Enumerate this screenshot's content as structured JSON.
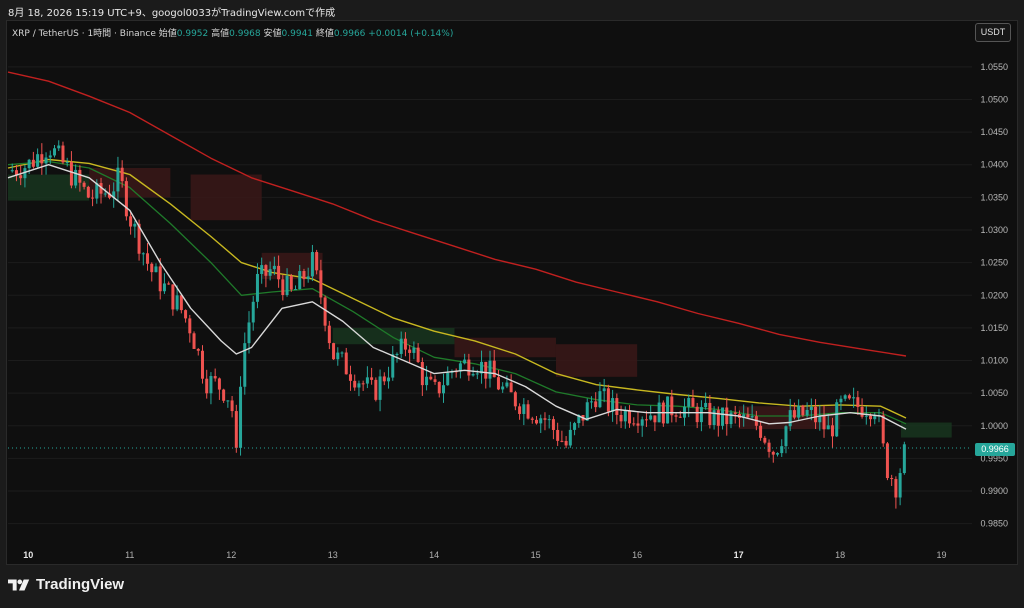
{
  "caption": "8月 18, 2026 15:19 UTC+9、googol0033がTradingView.comで作成",
  "legend": {
    "symbol": "XRP / TetherUS · 1時間 · Binance",
    "open_label": "始値",
    "open": "0.9952",
    "high_label": "高値",
    "high": "0.9968",
    "low_label": "安値",
    "low": "0.9941",
    "close_label": "終値",
    "close": "0.9966",
    "change": "+0.0014 (+0.14%)"
  },
  "currency_button": "USDT",
  "last_price_tag": "0.9966",
  "footer_brand": "TradingView",
  "colors": {
    "up": "#26a69a",
    "down": "#ef5350",
    "ma_white": "#d9d9d9",
    "ma_green": "#1f7a2a",
    "ma_yellow": "#c8b820",
    "ma_red": "#c0201f",
    "cloud_green": "#17351f",
    "cloud_red": "#3a1717"
  },
  "chart_data": {
    "type": "candlestick",
    "x_tick_labels": [
      "10",
      "11",
      "12",
      "13",
      "14",
      "15",
      "16",
      "17",
      "18",
      "19"
    ],
    "bold_x_ticks": [
      "10",
      "17"
    ],
    "y_tick_labels": [
      "1.0550",
      "1.0500",
      "1.0450",
      "1.0400",
      "1.0350",
      "1.0300",
      "1.0250",
      "1.0200",
      "1.0150",
      "1.0100",
      "1.0050",
      "1.0000",
      "0.9950",
      "0.9900",
      "0.9850"
    ],
    "ylim": [
      0.9825,
      1.0585
    ],
    "xlim_days": [
      9.8,
      19.3
    ],
    "last_price": 0.9966,
    "approx_path_close": [
      [
        9.8,
        1.039
      ],
      [
        10.0,
        1.04
      ],
      [
        10.2,
        1.043
      ],
      [
        10.4,
        1.039
      ],
      [
        10.6,
        1.035
      ],
      [
        10.8,
        1.036
      ],
      [
        10.9,
        1.038
      ],
      [
        11.0,
        1.032
      ],
      [
        11.2,
        1.024
      ],
      [
        11.5,
        1.018
      ],
      [
        11.6,
        1.015
      ],
      [
        11.75,
        1.007
      ],
      [
        11.9,
        1.006
      ],
      [
        12.0,
        1.004
      ],
      [
        12.05,
        0.995
      ],
      [
        12.1,
        1.01
      ],
      [
        12.25,
        1.022
      ],
      [
        12.4,
        1.024
      ],
      [
        12.6,
        1.02
      ],
      [
        12.8,
        1.025
      ],
      [
        12.9,
        1.019
      ],
      [
        13.0,
        1.011
      ],
      [
        13.2,
        1.008
      ],
      [
        13.4,
        1.005
      ],
      [
        13.6,
        1.01
      ],
      [
        13.75,
        1.013
      ],
      [
        13.9,
        1.007
      ],
      [
        14.0,
        1.005
      ],
      [
        14.2,
        1.009
      ],
      [
        14.4,
        1.01
      ],
      [
        14.55,
        1.008
      ],
      [
        14.7,
        1.005
      ],
      [
        14.9,
        1.003
      ],
      [
        15.1,
        1.001
      ],
      [
        15.3,
        0.997
      ],
      [
        15.4,
        1.0
      ],
      [
        15.6,
        1.005
      ],
      [
        15.8,
        1.002
      ],
      [
        16.0,
        1.002
      ],
      [
        16.2,
        1.002
      ],
      [
        16.4,
        1.003
      ],
      [
        16.6,
        1.002
      ],
      [
        16.8,
        1.001
      ],
      [
        17.0,
        1.001
      ],
      [
        17.2,
        1.0
      ],
      [
        17.35,
        0.996
      ],
      [
        17.5,
        1.001
      ],
      [
        17.7,
        1.002
      ],
      [
        17.9,
        0.999
      ],
      [
        18.0,
        1.003
      ],
      [
        18.2,
        1.003
      ],
      [
        18.35,
        1.003
      ],
      [
        18.45,
        0.994
      ],
      [
        18.55,
        0.991
      ],
      [
        18.65,
        0.9966
      ]
    ],
    "ma_white": [
      [
        9.8,
        1.038
      ],
      [
        10.2,
        1.04
      ],
      [
        10.6,
        1.038
      ],
      [
        11.0,
        1.033
      ],
      [
        11.3,
        1.025
      ],
      [
        11.6,
        1.018
      ],
      [
        11.9,
        1.013
      ],
      [
        12.05,
        1.011
      ],
      [
        12.2,
        1.012
      ],
      [
        12.5,
        1.018
      ],
      [
        12.8,
        1.019
      ],
      [
        13.1,
        1.016
      ],
      [
        13.4,
        1.012
      ],
      [
        13.7,
        1.01
      ],
      [
        14.0,
        1.008
      ],
      [
        14.3,
        1.0085
      ],
      [
        14.6,
        1.008
      ],
      [
        14.9,
        1.006
      ],
      [
        15.2,
        1.003
      ],
      [
        15.5,
        1.001
      ],
      [
        15.8,
        1.0025
      ],
      [
        16.1,
        1.002
      ],
      [
        16.4,
        1.002
      ],
      [
        16.7,
        1.002
      ],
      [
        17.0,
        1.0015
      ],
      [
        17.3,
        1.0003
      ],
      [
        17.5,
        1.0005
      ],
      [
        17.8,
        1.0015
      ],
      [
        18.1,
        1.002
      ],
      [
        18.4,
        1.0015
      ],
      [
        18.65,
        0.9995
      ]
    ],
    "ma_green": [
      [
        9.8,
        1.04
      ],
      [
        10.2,
        1.0405
      ],
      [
        10.6,
        1.0395
      ],
      [
        11.0,
        1.0365
      ],
      [
        11.4,
        1.031
      ],
      [
        11.8,
        1.025
      ],
      [
        12.1,
        1.02
      ],
      [
        12.4,
        1.0205
      ],
      [
        12.8,
        1.021
      ],
      [
        13.2,
        1.0175
      ],
      [
        13.6,
        1.0135
      ],
      [
        14.0,
        1.0105
      ],
      [
        14.4,
        1.0095
      ],
      [
        14.8,
        1.008
      ],
      [
        15.2,
        1.0052
      ],
      [
        15.6,
        1.004
      ],
      [
        16.0,
        1.0032
      ],
      [
        16.4,
        1.003
      ],
      [
        16.8,
        1.0025
      ],
      [
        17.2,
        1.0015
      ],
      [
        17.6,
        1.0015
      ],
      [
        18.0,
        1.002
      ],
      [
        18.4,
        1.002
      ],
      [
        18.65,
        1.0003
      ]
    ],
    "ma_yellow": [
      [
        9.8,
        1.0395
      ],
      [
        10.2,
        1.0408
      ],
      [
        10.6,
        1.0402
      ],
      [
        11.0,
        1.0385
      ],
      [
        11.4,
        1.034
      ],
      [
        11.8,
        1.029
      ],
      [
        12.1,
        1.025
      ],
      [
        12.4,
        1.0235
      ],
      [
        12.8,
        1.0225
      ],
      [
        13.2,
        1.0195
      ],
      [
        13.6,
        1.0165
      ],
      [
        14.0,
        1.0145
      ],
      [
        14.4,
        1.013
      ],
      [
        14.8,
        1.011
      ],
      [
        15.2,
        1.008
      ],
      [
        15.6,
        1.0063
      ],
      [
        16.0,
        1.0055
      ],
      [
        16.4,
        1.0048
      ],
      [
        16.8,
        1.0042
      ],
      [
        17.2,
        1.0035
      ],
      [
        17.6,
        1.003
      ],
      [
        18.0,
        1.0032
      ],
      [
        18.4,
        1.003
      ],
      [
        18.65,
        1.0012
      ]
    ],
    "ma_red": [
      [
        9.8,
        1.0542
      ],
      [
        10.2,
        1.0528
      ],
      [
        10.6,
        1.0505
      ],
      [
        11.0,
        1.048
      ],
      [
        11.4,
        1.0445
      ],
      [
        11.8,
        1.041
      ],
      [
        12.2,
        1.038
      ],
      [
        12.6,
        1.036
      ],
      [
        13.0,
        1.034
      ],
      [
        13.4,
        1.0315
      ],
      [
        13.8,
        1.0295
      ],
      [
        14.2,
        1.0275
      ],
      [
        14.6,
        1.0255
      ],
      [
        15.0,
        1.024
      ],
      [
        15.4,
        1.022
      ],
      [
        15.8,
        1.0205
      ],
      [
        16.2,
        1.019
      ],
      [
        16.6,
        1.0172
      ],
      [
        17.0,
        1.0157
      ],
      [
        17.4,
        1.014
      ],
      [
        17.8,
        1.0128
      ],
      [
        18.2,
        1.0118
      ],
      [
        18.65,
        1.0107
      ]
    ],
    "cloud_bands": [
      {
        "color": "green",
        "from": 9.8,
        "to": 10.6,
        "top": 1.0385,
        "bottom": 1.0345
      },
      {
        "color": "red",
        "from": 10.6,
        "to": 11.4,
        "top": 1.0395,
        "bottom": 1.035
      },
      {
        "color": "red",
        "from": 11.6,
        "to": 12.3,
        "top": 1.0385,
        "bottom": 1.0315
      },
      {
        "color": "red",
        "from": 12.3,
        "to": 12.9,
        "top": 1.0265,
        "bottom": 1.0225
      },
      {
        "color": "green",
        "from": 13.0,
        "to": 14.2,
        "top": 1.015,
        "bottom": 1.0125
      },
      {
        "color": "red",
        "from": 14.2,
        "to": 15.2,
        "top": 1.0135,
        "bottom": 1.0105
      },
      {
        "color": "red",
        "from": 15.2,
        "to": 16.0,
        "top": 1.0125,
        "bottom": 1.0075
      },
      {
        "color": "red",
        "from": 17.0,
        "to": 18.0,
        "top": 1.003,
        "bottom": 0.9995
      },
      {
        "color": "green",
        "from": 18.6,
        "to": 19.1,
        "top": 1.0005,
        "bottom": 0.9982
      }
    ]
  }
}
